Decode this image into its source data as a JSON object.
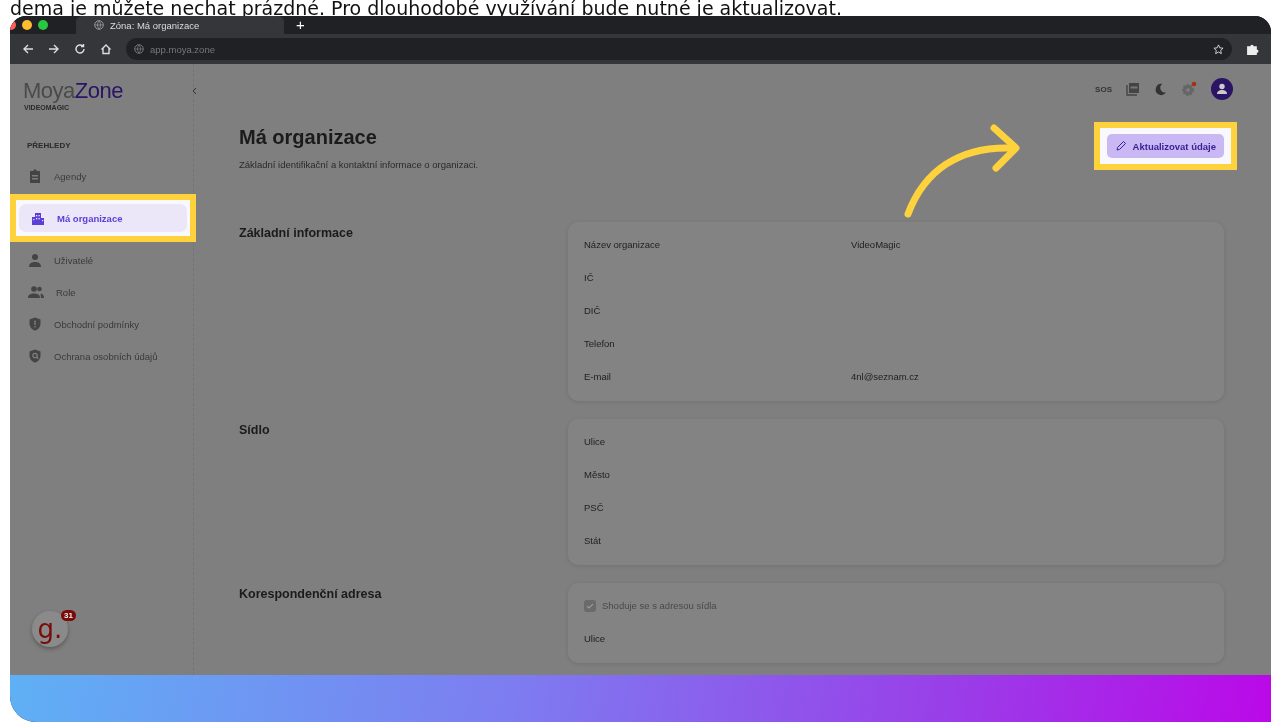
{
  "caption": "dema je můžete nechat prázdné. Pro dlouhodobé využívání bude nutné je aktualizovat.",
  "browser": {
    "tab_title": "Zóna: Má organizace",
    "new_tab": "+",
    "url": "app.moya.zone"
  },
  "sidebar": {
    "logo_left": "Moya",
    "logo_right": "Zone",
    "org": "VIDEOMAGIC",
    "section": "PŘEHLEDY",
    "items": [
      {
        "label": "Agendy",
        "selected": false
      },
      {
        "label": "Má organizace",
        "selected": true
      },
      {
        "label": "Uživatelé",
        "selected": false
      },
      {
        "label": "Role",
        "selected": false
      },
      {
        "label": "Obchodní podmínky",
        "selected": false
      },
      {
        "label": "Ochrana osobních údajů",
        "selected": false
      }
    ]
  },
  "topbar": {
    "sos": "SOS"
  },
  "page": {
    "title": "Má organizace",
    "subtitle": "Základní identifikační a kontaktní informace o organizaci.",
    "button": "Aktualizovat údaje"
  },
  "sections": [
    {
      "title": "Základní informace",
      "fields": [
        {
          "kind": "field",
          "label": "Název organizace",
          "value": "VideoMagic"
        },
        {
          "kind": "field",
          "label": "IČ"
        },
        {
          "kind": "field",
          "label": "DIČ"
        },
        {
          "kind": "field",
          "label": "Telefon"
        },
        {
          "kind": "field",
          "label": "E-mail",
          "value": "4nl@seznam.cz"
        }
      ]
    },
    {
      "title": "Sídlo",
      "fields": [
        {
          "kind": "field",
          "label": "Ulice"
        },
        {
          "kind": "field",
          "label": "Město"
        },
        {
          "kind": "field",
          "label": "PSČ"
        },
        {
          "kind": "field",
          "label": "Stát"
        }
      ]
    },
    {
      "title": "Korespondenční adresa",
      "fields": [
        {
          "kind": "checkbox",
          "label": "Shoduje se s adresou sídla",
          "checked": true
        },
        {
          "kind": "field",
          "label": "Ulice"
        }
      ]
    }
  ],
  "widget": {
    "logo": "g.",
    "count": "31"
  }
}
